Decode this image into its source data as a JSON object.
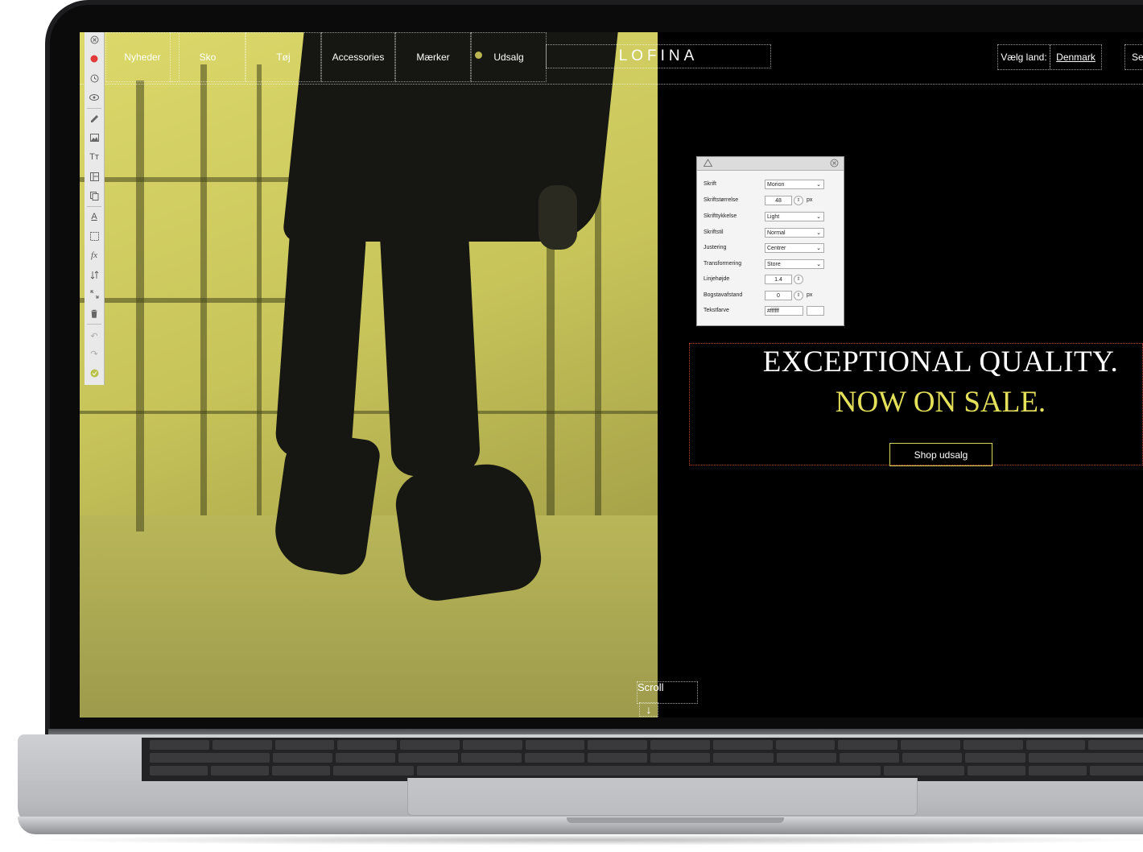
{
  "nav": {
    "items": [
      "Nyheder",
      "Sko",
      "Tøj",
      "Accessories",
      "Mærker",
      "Udsalg"
    ],
    "logo": "LOFINA",
    "country_label": "Vælg land:",
    "country_value": "Denmark",
    "search_partial": "Se"
  },
  "toolbar": {
    "icons": [
      "close-icon",
      "record-icon",
      "clock-icon",
      "eye-icon",
      "pencil-icon",
      "image-icon",
      "text-size-icon",
      "layout-icon",
      "copy-icon",
      "text-color-icon",
      "frame-icon",
      "function-icon",
      "sort-icon",
      "resize-icon",
      "trash-icon",
      "undo-icon",
      "redo-icon",
      "check-icon"
    ],
    "labels": {
      "text_size": "Tт",
      "function": "fx",
      "text_color": "A"
    }
  },
  "inspector": {
    "rows": [
      {
        "label": "Skrift",
        "value": "Morion",
        "kind": "select"
      },
      {
        "label": "Skriftstørrelse",
        "value": "48",
        "kind": "number",
        "unit": "px"
      },
      {
        "label": "Skrifttykkelse",
        "value": "Light",
        "kind": "select"
      },
      {
        "label": "Skriftstil",
        "value": "Normal",
        "kind": "select"
      },
      {
        "label": "Justering",
        "value": "Centrer",
        "kind": "select"
      },
      {
        "label": "Transformering",
        "value": "Store",
        "kind": "select"
      },
      {
        "label": "Linjehøjde",
        "value": "1.4",
        "kind": "number",
        "unit": ""
      },
      {
        "label": "Bogstavafstand",
        "value": "0",
        "kind": "number",
        "unit": "px"
      },
      {
        "label": "Tekstfarve",
        "value": "#ffffff",
        "kind": "color"
      }
    ]
  },
  "hero": {
    "headline": "EXCEPTIONAL QUALITY.",
    "subheadline": "NOW ON SALE.",
    "cta": "Shop udsalg",
    "scroll_label": "Scroll",
    "scroll_arrow": "↓"
  },
  "colors": {
    "accent_yellow": "#e4e05a",
    "background": "#000000",
    "selection_red": "#c2462a",
    "photo_tint": "#d4d166"
  }
}
